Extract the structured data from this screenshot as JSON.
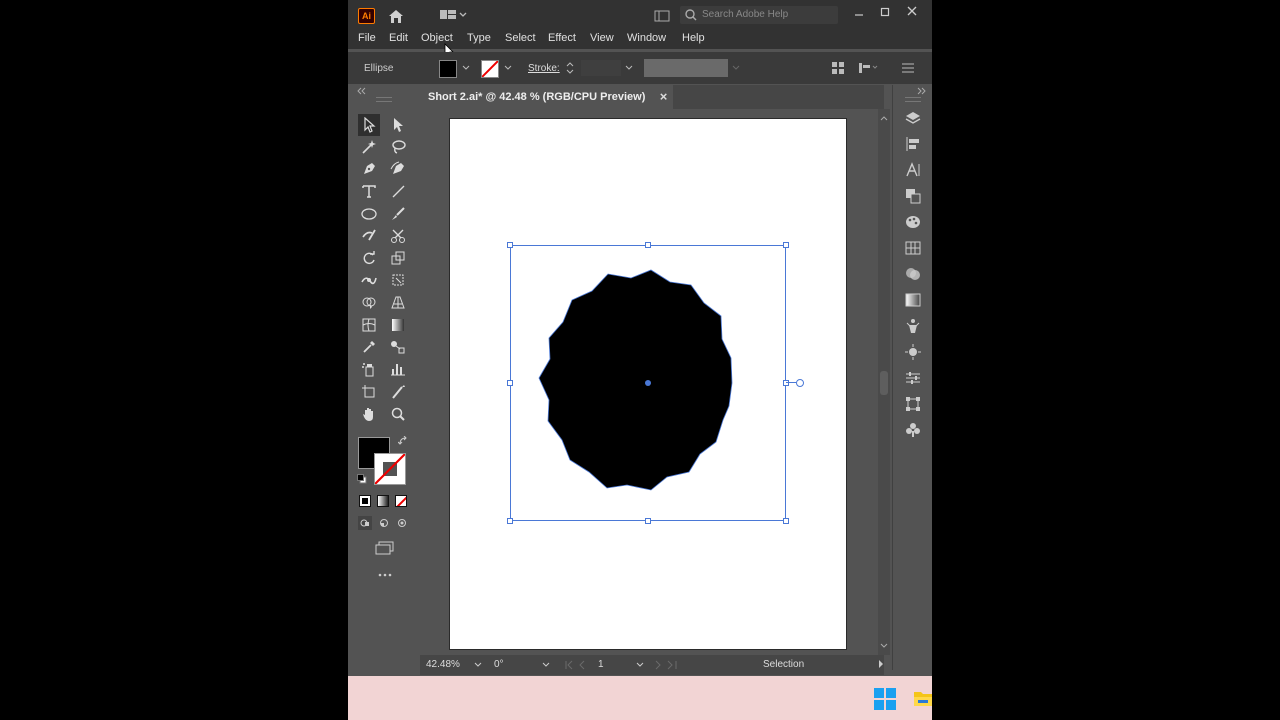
{
  "app": {
    "logo_text": "Ai"
  },
  "titlebar": {
    "search_placeholder": "Search Adobe Help"
  },
  "menu": [
    "File",
    "Edit",
    "Object",
    "Type",
    "Select",
    "Effect",
    "View",
    "Window",
    "Help"
  ],
  "control": {
    "selection_label": "Ellipse",
    "stroke_label": "Stroke:"
  },
  "document": {
    "tab_title": "Short 2.ai* @ 42.48 % (RGB/CPU Preview)",
    "close_glyph": "×"
  },
  "status": {
    "zoom": "42.48%",
    "rotation": "0°",
    "artboard": "1",
    "tool": "Selection"
  },
  "colors": {
    "accent": "#4a78d6",
    "artwork_fill": "#000000",
    "taskbar": "#f2d4d4"
  }
}
